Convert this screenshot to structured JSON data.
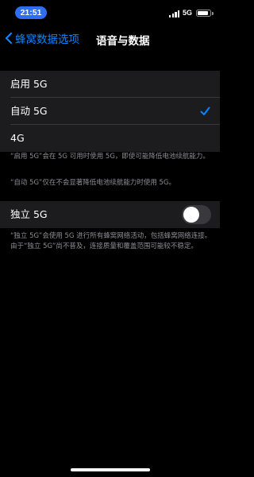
{
  "status_bar": {
    "time": "21:51",
    "network_type": "5G",
    "signal_bars": 4,
    "battery_level": 0.85,
    "time_pill_color": "#2f6ef3"
  },
  "nav": {
    "back_label": "蜂窝数据选项",
    "title": "语音与数据",
    "back_icon": "chevron-left-icon",
    "accent_color": "#0a84ff"
  },
  "options": {
    "items": [
      {
        "label": "启用 5G",
        "selected": false
      },
      {
        "label": "自动 5G",
        "selected": true
      },
      {
        "label": "4G",
        "selected": false
      }
    ],
    "check_icon": "checkmark-icon"
  },
  "footnotes": {
    "enable_5g": "“启用 5G”会在 5G 可用时使用 5G，即使可能降低电池续航能力。",
    "auto_5g": "“自动 5G”仅在不会显著降低电池续航能力时使用 5G。"
  },
  "standalone": {
    "label": "独立 5G",
    "enabled": false,
    "footnote": "“独立 5G”会使用 5G 进行所有蜂窝网络活动，包括蜂窝网络连接。由于“独立 5G”尚不普及，连接质量和覆盖范围可能较不稳定。"
  }
}
